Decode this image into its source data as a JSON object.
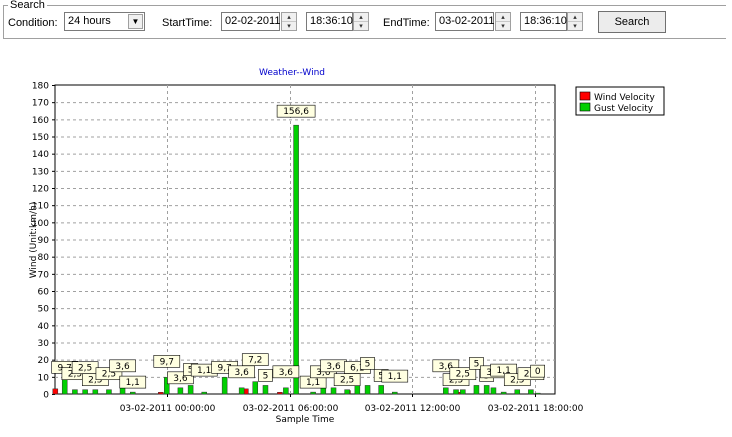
{
  "search": {
    "group_label": "Search",
    "condition_label": "Condition:",
    "condition_value": "24 hours",
    "start_label": "StartTime:",
    "start_date": "02-02-2011",
    "start_time": "18:36:10",
    "end_label": "EndTime:",
    "end_date": "03-02-2011",
    "end_time": "18:36:10",
    "search_label": "Search",
    "combo_arrow": "▼",
    "spin_up": "▴",
    "spin_down": "▾"
  },
  "icons": {
    "dropdown": "chevron-down-icon",
    "spin": "spin-arrows-icon"
  },
  "chart_data": {
    "type": "bar",
    "title": "Weather--Wind",
    "xlabel": "Sample Time",
    "ylabel": "Wind (Unit:km/h)",
    "ylim": [
      0,
      180
    ],
    "yticks": [
      0,
      10,
      20,
      30,
      40,
      50,
      60,
      70,
      80,
      90,
      100,
      110,
      120,
      130,
      140,
      150,
      160,
      170,
      180
    ],
    "xlim": [
      "02-02-2011 18:36:10",
      "03-02-2011 18:36:10"
    ],
    "xticks": [
      "03-02-2011 00:00:00",
      "03-02-2011 06:00:00",
      "03-02-2011 12:00:00",
      "03-02-2011 18:00:00"
    ],
    "grid": true,
    "legend": "top-right",
    "series": [
      {
        "name": "Wind Velocity",
        "color": "#ff0000",
        "x": [
          "02-02-2011 18:40",
          "02-02-2011 23:50",
          "03-02-2011 04:00",
          "03-02-2011 05:40",
          "03-02-2011 09:00",
          "03-02-2011 14:30"
        ],
        "values": [
          3,
          1,
          3,
          1,
          2,
          1
        ]
      },
      {
        "name": "Gust Velocity",
        "color": "#00d000",
        "x": [
          "02-02-2011 18:50",
          "02-02-2011 19:20",
          "02-02-2011 19:50",
          "02-02-2011 20:20",
          "02-02-2011 21:00",
          "02-02-2011 21:40",
          "02-02-2011 22:10",
          "02-02-2011 23:50",
          "02-02-2011 00:30",
          "03-02-2011 00:30",
          "03-02-2011 01:00",
          "03-02-2011 01:40",
          "03-02-2011 02:40",
          "03-02-2011 03:30",
          "03-02-2011 04:10",
          "03-02-2011 04:40",
          "03-02-2011 05:40",
          "03-02-2011 06:10",
          "03-02-2011 07:00",
          "03-02-2011 07:30",
          "03-02-2011 08:00",
          "03-02-2011 08:40",
          "03-02-2011 09:10",
          "03-02-2011 09:40",
          "03-02-2011 10:20",
          "03-02-2011 11:00",
          "03-02-2011 13:30",
          "03-02-2011 14:00",
          "03-02-2011 14:20",
          "03-02-2011 15:00",
          "03-02-2011 15:30",
          "03-02-2011 15:50",
          "03-02-2011 16:20",
          "03-02-2011 17:00",
          "03-02-2011 17:40",
          "03-02-2011 18:00"
        ],
        "values": [
          9.7,
          2.5,
          2.5,
          2.5,
          2.5,
          3.6,
          1.1,
          9.7,
          3.6,
          3.6,
          5,
          1.1,
          9.7,
          3.6,
          7.2,
          5,
          3.6,
          156.6,
          1.1,
          3.6,
          3.6,
          2.5,
          6.1,
          5,
          5,
          1.1,
          3.6,
          2.5,
          2.5,
          5,
          5,
          3.6,
          1.1,
          2.5,
          2.5,
          0.5
        ],
        "labels": [
          "9,7",
          "2,5",
          "2,5",
          "2,5",
          "2,5",
          "3,6",
          "1,1",
          "9,7",
          "3,6",
          "3,6",
          "5",
          "1,1",
          "9,7",
          "3,6",
          "7,2",
          "5",
          "3,6",
          "156,6",
          "1,1",
          "3,6",
          "3,6",
          "2,5",
          "6,1",
          "5",
          "5",
          "1,1",
          "3,6",
          "2,5",
          "2,5",
          "5",
          "5",
          "3,6",
          "1,1",
          "2,5",
          "2,5",
          "0"
        ]
      }
    ]
  }
}
